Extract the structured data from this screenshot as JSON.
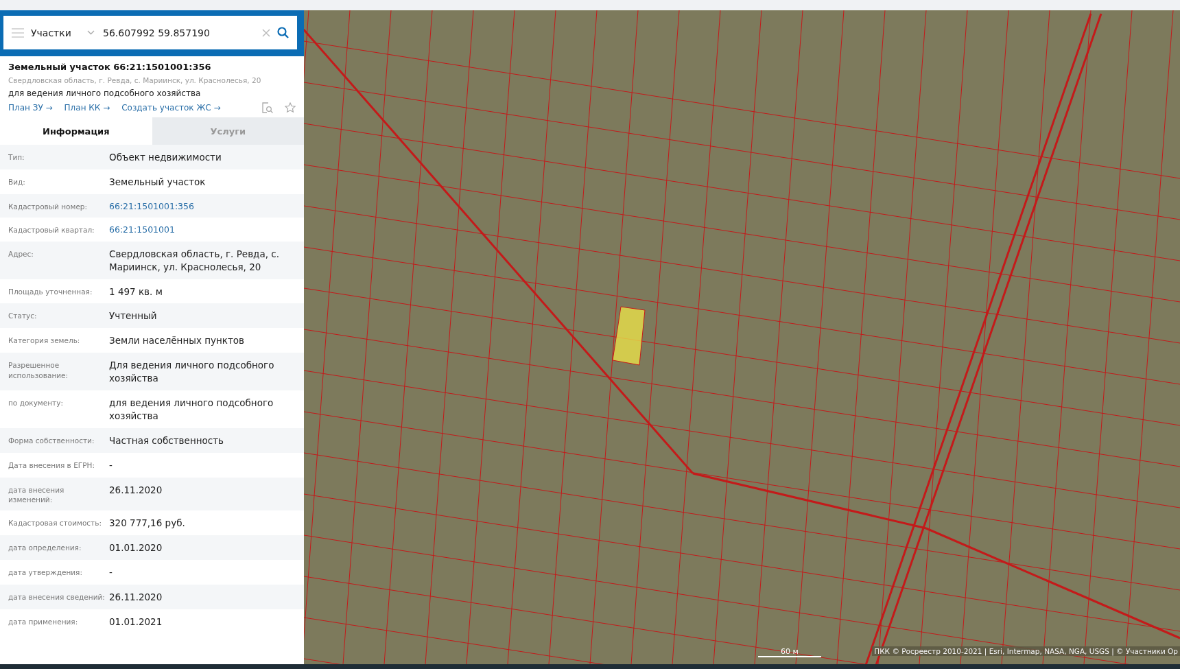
{
  "search": {
    "layer": "Участки",
    "value": "56.607992 59.857190"
  },
  "parcel": {
    "title": "Земельный участок 66:21:1501001:356",
    "address": "Свердловская область, г. Ревда, с. Мариинск, ул. Краснолесья, 20",
    "purpose": "для ведения личного подсобного хозяйства",
    "links": [
      "План ЗУ →",
      "План КК →",
      "Создать участок ЖС →"
    ]
  },
  "tabs": [
    {
      "label": "Информация",
      "selected": true
    },
    {
      "label": "Услуги",
      "selected": false
    }
  ],
  "info_rows": [
    {
      "label": "Тип:",
      "value": "Объект недвижимости"
    },
    {
      "label": "Вид:",
      "value": "Земельный участок"
    },
    {
      "label": "Кадастровый номер:",
      "value": "66:21:1501001:356",
      "kind": "link"
    },
    {
      "label": "Кадастровый квартал:",
      "value": "66:21:1501001",
      "kind": "link"
    },
    {
      "label": "Адрес:",
      "value": "Свердловская область, г. Ревда, с. Мариинск, ул. Краснолесья, 20"
    },
    {
      "label": "Площадь уточненная:",
      "value": "1 497 кв. м"
    },
    {
      "label": "Статус:",
      "value": "Учтенный"
    },
    {
      "label": "Категория земель:",
      "value": "Земли населённых пунктов"
    },
    {
      "label": "Разрешенное использование:",
      "value": "Для ведения личного подсобного хозяйства"
    },
    {
      "label": "по документу:",
      "value": "для ведения личного подсобного хозяйства"
    },
    {
      "label": "Форма собственности:",
      "value": "Частная собственность"
    },
    {
      "label": "Дата внесения в ЕГРН:",
      "value": "-"
    },
    {
      "label": "дата внесения изменений:",
      "value": "26.11.2020"
    },
    {
      "label": "Кадастровая стоимость:",
      "value": "320 777,16 руб."
    },
    {
      "label": "дата определения:",
      "value": "01.01.2020"
    },
    {
      "label": "дата утверждения:",
      "value": "-"
    },
    {
      "label": "дата внесения сведений:",
      "value": "26.11.2020"
    },
    {
      "label": "дата применения:",
      "value": "01.01.2021"
    }
  ],
  "map": {
    "scale": "60 м",
    "attribution": "ПКК © Росреестр 2010-2021 | Esri, Intermap, NASA, NGA, USGS | © Участники Op"
  }
}
